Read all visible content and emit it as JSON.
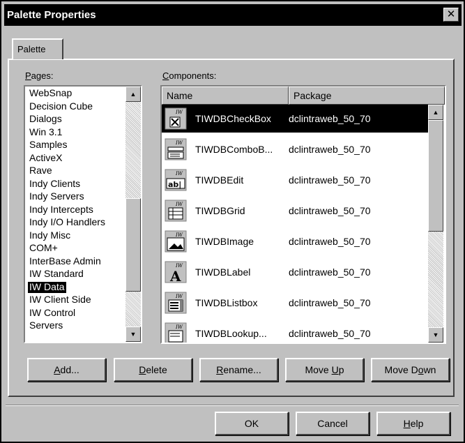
{
  "window": {
    "title": "Palette Properties",
    "close_glyph": "✕"
  },
  "tab": {
    "label": "Palette"
  },
  "pages": {
    "label": "Pages:",
    "items": [
      "WebSnap",
      "Decision Cube",
      "Dialogs",
      "Win 3.1",
      "Samples",
      "ActiveX",
      "Rave",
      "Indy Clients",
      "Indy Servers",
      "Indy Intercepts",
      "Indy I/O Handlers",
      "Indy Misc",
      "COM+",
      "InterBase Admin",
      "IW Standard",
      "IW Data",
      "IW Client Side",
      "IW Control",
      "Servers"
    ],
    "selected": "IW Data"
  },
  "components": {
    "label": "Components:",
    "columns": {
      "name": "Name",
      "package": "Package"
    },
    "rows": [
      {
        "name": "TIWDBCheckBox",
        "package": "dclintraweb_50_70",
        "icon": "checkbox-icon",
        "selected": true
      },
      {
        "name": "TIWDBComboB...",
        "package": "dclintraweb_50_70",
        "icon": "combobox-icon"
      },
      {
        "name": "TIWDBEdit",
        "package": "dclintraweb_50_70",
        "icon": "edit-icon"
      },
      {
        "name": "TIWDBGrid",
        "package": "dclintraweb_50_70",
        "icon": "grid-icon"
      },
      {
        "name": "TIWDBImage",
        "package": "dclintraweb_50_70",
        "icon": "image-icon"
      },
      {
        "name": "TIWDBLabel",
        "package": "dclintraweb_50_70",
        "icon": "label-icon"
      },
      {
        "name": "TIWDBListbox",
        "package": "dclintraweb_50_70",
        "icon": "listbox-icon"
      },
      {
        "name": "TIWDBLookup...",
        "package": "dclintraweb_50_70",
        "icon": "lookup-icon"
      }
    ]
  },
  "buttons": {
    "add": "Add...",
    "delete": "Delete",
    "rename": "Rename...",
    "move_up": "Move Up",
    "move_down": "Move Down",
    "ok": "OK",
    "cancel": "Cancel",
    "help": "Help"
  },
  "colors": {
    "face": "#c0c0c0",
    "title_bg": "#000000",
    "selection": "#000000"
  }
}
